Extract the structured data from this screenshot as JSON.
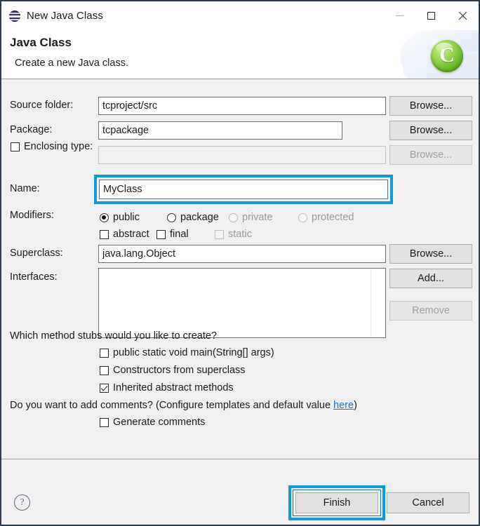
{
  "window": {
    "title": "New Java Class",
    "title_icon": "java-class-sphere-icon",
    "controls": {
      "minimize": "minimize-icon",
      "maximize": "maximize-icon",
      "close": "close-icon"
    }
  },
  "header": {
    "title": "Java Class",
    "subtitle": "Create a new Java class.",
    "logo_letter": "C",
    "logo_icon": "green-class-wizard-icon"
  },
  "form": {
    "source_folder": {
      "label": "Source folder:",
      "value": "tcproject/src",
      "button": "Browse..."
    },
    "package": {
      "label": "Package:",
      "value": "tcpackage",
      "button": "Browse..."
    },
    "enclosing_type": {
      "label": "Enclosing type:",
      "checked": false,
      "value": "",
      "button": "Browse...",
      "disabled": true
    },
    "name": {
      "label": "Name:",
      "value": "MyClass",
      "highlighted": true
    },
    "modifiers": {
      "label": "Modifiers:",
      "radios": [
        {
          "label": "public",
          "checked": true,
          "disabled": false
        },
        {
          "label": "package",
          "checked": false,
          "disabled": false
        },
        {
          "label": "private",
          "checked": false,
          "disabled": true
        },
        {
          "label": "protected",
          "checked": false,
          "disabled": true
        }
      ],
      "checkboxes": [
        {
          "label": "abstract",
          "checked": false,
          "disabled": false
        },
        {
          "label": "final",
          "checked": false,
          "disabled": false
        },
        {
          "label": "static",
          "checked": false,
          "disabled": true
        }
      ]
    },
    "superclass": {
      "label": "Superclass:",
      "value": "java.lang.Object",
      "button": "Browse..."
    },
    "interfaces": {
      "label": "Interfaces:",
      "items": [],
      "add_button": "Add...",
      "remove_button": "Remove",
      "remove_disabled": true
    },
    "stubs": {
      "question": "Which method stubs would you like to create?",
      "options": [
        {
          "label": "public static void main(String[] args)",
          "checked": false
        },
        {
          "label": "Constructors from superclass",
          "checked": false
        },
        {
          "label": "Inherited abstract methods",
          "checked": true
        }
      ]
    },
    "comments": {
      "question_prefix": "Do you want to add comments? (Configure templates and default value ",
      "link": "here",
      "question_suffix": ")",
      "option": {
        "label": "Generate comments",
        "checked": false
      }
    }
  },
  "footer": {
    "help_icon": "help-question-icon",
    "finish": "Finish",
    "cancel": "Cancel",
    "finish_highlighted": true
  },
  "colors": {
    "annotation": "#0f9bd7",
    "link": "#1a6fd4",
    "window_border": "#2d3c4c",
    "dialog_bg": "#f0f0f0",
    "button_bg": "#e1e1e1"
  }
}
